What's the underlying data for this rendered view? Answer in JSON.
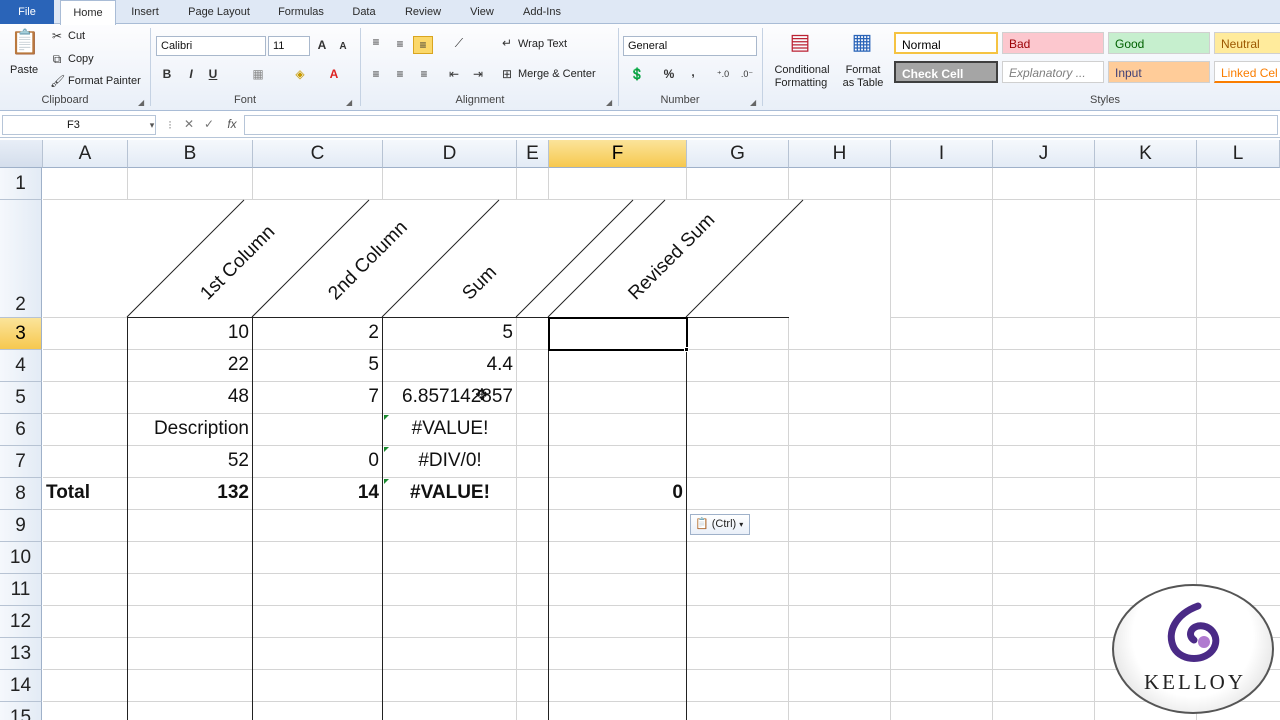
{
  "tabs": [
    "File",
    "Home",
    "Insert",
    "Page Layout",
    "Formulas",
    "Data",
    "Review",
    "View",
    "Add-Ins"
  ],
  "clipboard": {
    "paste": "Paste",
    "cut": "Cut",
    "copy": "Copy",
    "format_painter": "Format Painter",
    "label": "Clipboard"
  },
  "font": {
    "name": "Calibri",
    "size": "11",
    "label": "Font",
    "bold": "B",
    "italic": "I",
    "underline": "U"
  },
  "alignment": {
    "wrap": "Wrap Text",
    "merge": "Merge & Center",
    "label": "Alignment"
  },
  "number": {
    "format": "General",
    "label": "Number",
    "percent": "%",
    "comma": ","
  },
  "conditional": {
    "line1": "Conditional",
    "line2": "Formatting"
  },
  "format_table": {
    "line1": "Format",
    "line2": "as Table"
  },
  "styles": {
    "label": "Styles",
    "normal": "Normal",
    "bad": "Bad",
    "good": "Good",
    "neutral": "Neutral",
    "check": "Check Cell",
    "explanatory": "Explanatory ...",
    "input": "Input",
    "linked": "Linked Cel"
  },
  "formula_bar": {
    "namebox": "F3",
    "formula": "",
    "fx": "fx"
  },
  "columns": [
    "A",
    "B",
    "C",
    "D",
    "E",
    "F",
    "G",
    "H",
    "I",
    "J",
    "K",
    "L"
  ],
  "rows": [
    "1",
    "2",
    "3",
    "4",
    "5",
    "6",
    "7",
    "8",
    "9",
    "10",
    "11",
    "12",
    "13",
    "14",
    "15"
  ],
  "headers": {
    "b": "1st Column",
    "c": "2nd Column",
    "d": "Sum",
    "f": "Revised Sum"
  },
  "cells": {
    "b3": "10",
    "c3": "2",
    "d3": "5",
    "b4": "22",
    "c4": "5",
    "d4": "4.4",
    "b5": "48",
    "c5": "7",
    "d5": "6.857142857",
    "b6": "Description",
    "d6": "#VALUE!",
    "b7": "52",
    "c7": "0",
    "d7": "#DIV/0!",
    "a8": "Total",
    "b8": "132",
    "c8": "14",
    "d8": "#VALUE!",
    "f8": "0"
  },
  "paste_options": "(Ctrl)",
  "logo_text": "KELLOY",
  "colors": {
    "accent": "#2a64b8",
    "selected_header": "#f6c84f",
    "error_triangle": "#1a8a2e"
  }
}
